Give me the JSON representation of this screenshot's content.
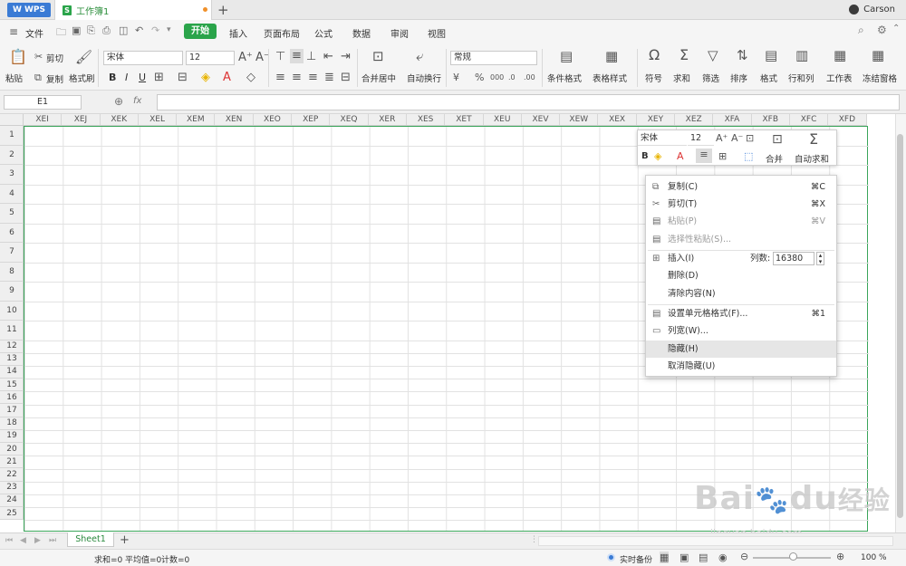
{
  "tabs": {
    "wps": "WPS",
    "doc": "工作簿1",
    "new": "+",
    "user": "Carson"
  },
  "menu": {
    "file": "文件",
    "items": [
      "开始",
      "插入",
      "页面布局",
      "公式",
      "数据",
      "审阅",
      "视图"
    ]
  },
  "ribbon": {
    "paste": "粘贴",
    "cut": "剪切",
    "copy": "复制",
    "format_painter": "格式刷",
    "font": "宋体",
    "size": "12",
    "bold": "B",
    "italic": "I",
    "underline": "U",
    "merge": "合并居中",
    "wrap": "自动换行",
    "numformat": "常规",
    "cond_format": "条件格式",
    "table_style": "表格样式",
    "symbol": "符号",
    "autosum": "求和",
    "filter": "筛选",
    "sort": "排序",
    "format": "格式",
    "rowcol": "行和列",
    "worksheet": "工作表",
    "freeze": "冻结窗格"
  },
  "formula_bar": {
    "name_box": "E1",
    "fx": "fx"
  },
  "columns": [
    "XEI",
    "XEJ",
    "XEK",
    "XEL",
    "XEM",
    "XEN",
    "XEO",
    "XEP",
    "XEQ",
    "XER",
    "XES",
    "XET",
    "XEU",
    "XEV",
    "XEW",
    "XEX",
    "XEY",
    "XEZ",
    "XFA",
    "XFB",
    "XFC",
    "XFD"
  ],
  "rows": [
    "1",
    "2",
    "3",
    "4",
    "5",
    "6",
    "7",
    "8",
    "9",
    "10",
    "11",
    "12",
    "13",
    "14",
    "15",
    "16",
    "17",
    "18",
    "19",
    "20",
    "21",
    "22",
    "23",
    "24",
    "25"
  ],
  "mini_toolbar": {
    "font": "宋体",
    "size": "12",
    "merge": "合并",
    "autosum": "自动求和",
    "bold": "B"
  },
  "context_menu": {
    "copy": "复制(C)",
    "copy_sc": "⌘C",
    "cut": "剪切(T)",
    "cut_sc": "⌘X",
    "paste": "粘贴(P)",
    "paste_sc": "⌘V",
    "paste_special": "选择性粘贴(S)...",
    "insert": "插入(I)",
    "col_count_label": "列数:",
    "col_count": "16380",
    "delete": "删除(D)",
    "clear": "清除内容(N)",
    "format_cells": "设置单元格格式(F)...",
    "format_sc": "⌘1",
    "col_width": "列宽(W)...",
    "hide": "隐藏(H)",
    "unhide": "取消隐藏(U)"
  },
  "sheets": {
    "sheet1": "Sheet1",
    "add": "+"
  },
  "status": {
    "sum": "求和=0",
    "avg": "平均值=0",
    "count": "计数=0",
    "backup": "实时备份",
    "zoom": "100 %"
  },
  "watermark": {
    "brand": "Bai",
    "brand2": "du",
    "cn": "经验",
    "url": "jingyan.baidu.com"
  },
  "colors": {
    "accent": "#2aa44a",
    "wps_blue": "#3a7bd5",
    "grid_border": "#3aa55a"
  }
}
